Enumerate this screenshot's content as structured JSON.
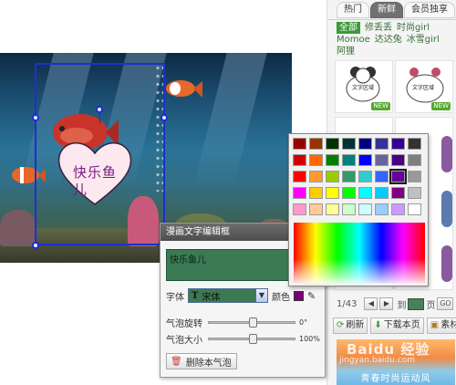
{
  "canvas": {
    "bubble_text": "快乐鱼儿"
  },
  "panel": {
    "tabs": [
      {
        "label": "热门",
        "active": false
      },
      {
        "label": "新鲜",
        "active": true
      },
      {
        "label": "会员独享",
        "active": false
      }
    ],
    "categories": [
      {
        "label": "全部",
        "active": true
      },
      {
        "label": "修丢丢",
        "active": false
      },
      {
        "label": "时尚girl",
        "active": false
      },
      {
        "label": "Momoe",
        "active": false
      },
      {
        "label": "达达兔",
        "active": false
      },
      {
        "label": "冰雪girl",
        "active": false
      },
      {
        "label": "阿狸",
        "active": false
      }
    ],
    "thumbnails": [
      {
        "label": "文字区域",
        "badge": "NEW"
      },
      {
        "label": "文字区域",
        "badge": "NEW"
      }
    ],
    "pager": {
      "current_label": "1/43",
      "prev_icon": "prev-arrow-icon",
      "next_icon": "next-arrow-icon",
      "goto_prefix": "到",
      "page_suffix": "页",
      "go_label": "GO"
    },
    "actions": [
      {
        "label": "刷新",
        "icon": "refresh-icon"
      },
      {
        "label": "下载本页",
        "icon": "download-icon"
      },
      {
        "label": "素材包",
        "icon": "package-icon"
      }
    ],
    "banner_text": "青春时尚运动风"
  },
  "editor": {
    "title": "漫画文字编辑框",
    "text_value": "快乐鱼儿",
    "font_label": "字体",
    "font_value": "宋体",
    "color_label": "颜色",
    "current_color": "#7a007a",
    "rotate_label": "气泡旋转",
    "rotate_value_text": "0°",
    "rotate_fraction": 0.5,
    "size_label": "气泡大小",
    "size_value_text": "100%",
    "size_fraction": 0.5,
    "delete_label": "删除本气泡"
  },
  "picker": {
    "selected_color": "#660099",
    "swatches": [
      [
        "#990000",
        "#993300",
        "#003300",
        "#003333",
        "#000080",
        "#333399",
        "#330099",
        "#333333"
      ],
      [
        "#cc0000",
        "#ff6600",
        "#008000",
        "#008080",
        "#0000ff",
        "#666699",
        "#4b0082",
        "#808080"
      ],
      [
        "#ff0000",
        "#ff9933",
        "#99cc00",
        "#339966",
        "#33cccc",
        "#3366ff",
        "#660099",
        "#999999"
      ],
      [
        "#ff00ff",
        "#ffcc00",
        "#ffff00",
        "#00ff00",
        "#00ffff",
        "#00ccff",
        "#800080",
        "#c0c0c0"
      ],
      [
        "#ff99cc",
        "#ffcc99",
        "#ffff99",
        "#ccffcc",
        "#ccffff",
        "#99ccff",
        "#cc99ff",
        "#ffffff"
      ]
    ]
  },
  "watermark": {
    "brand": "Baidu 经验",
    "url": "jingyan.baidu.com"
  }
}
